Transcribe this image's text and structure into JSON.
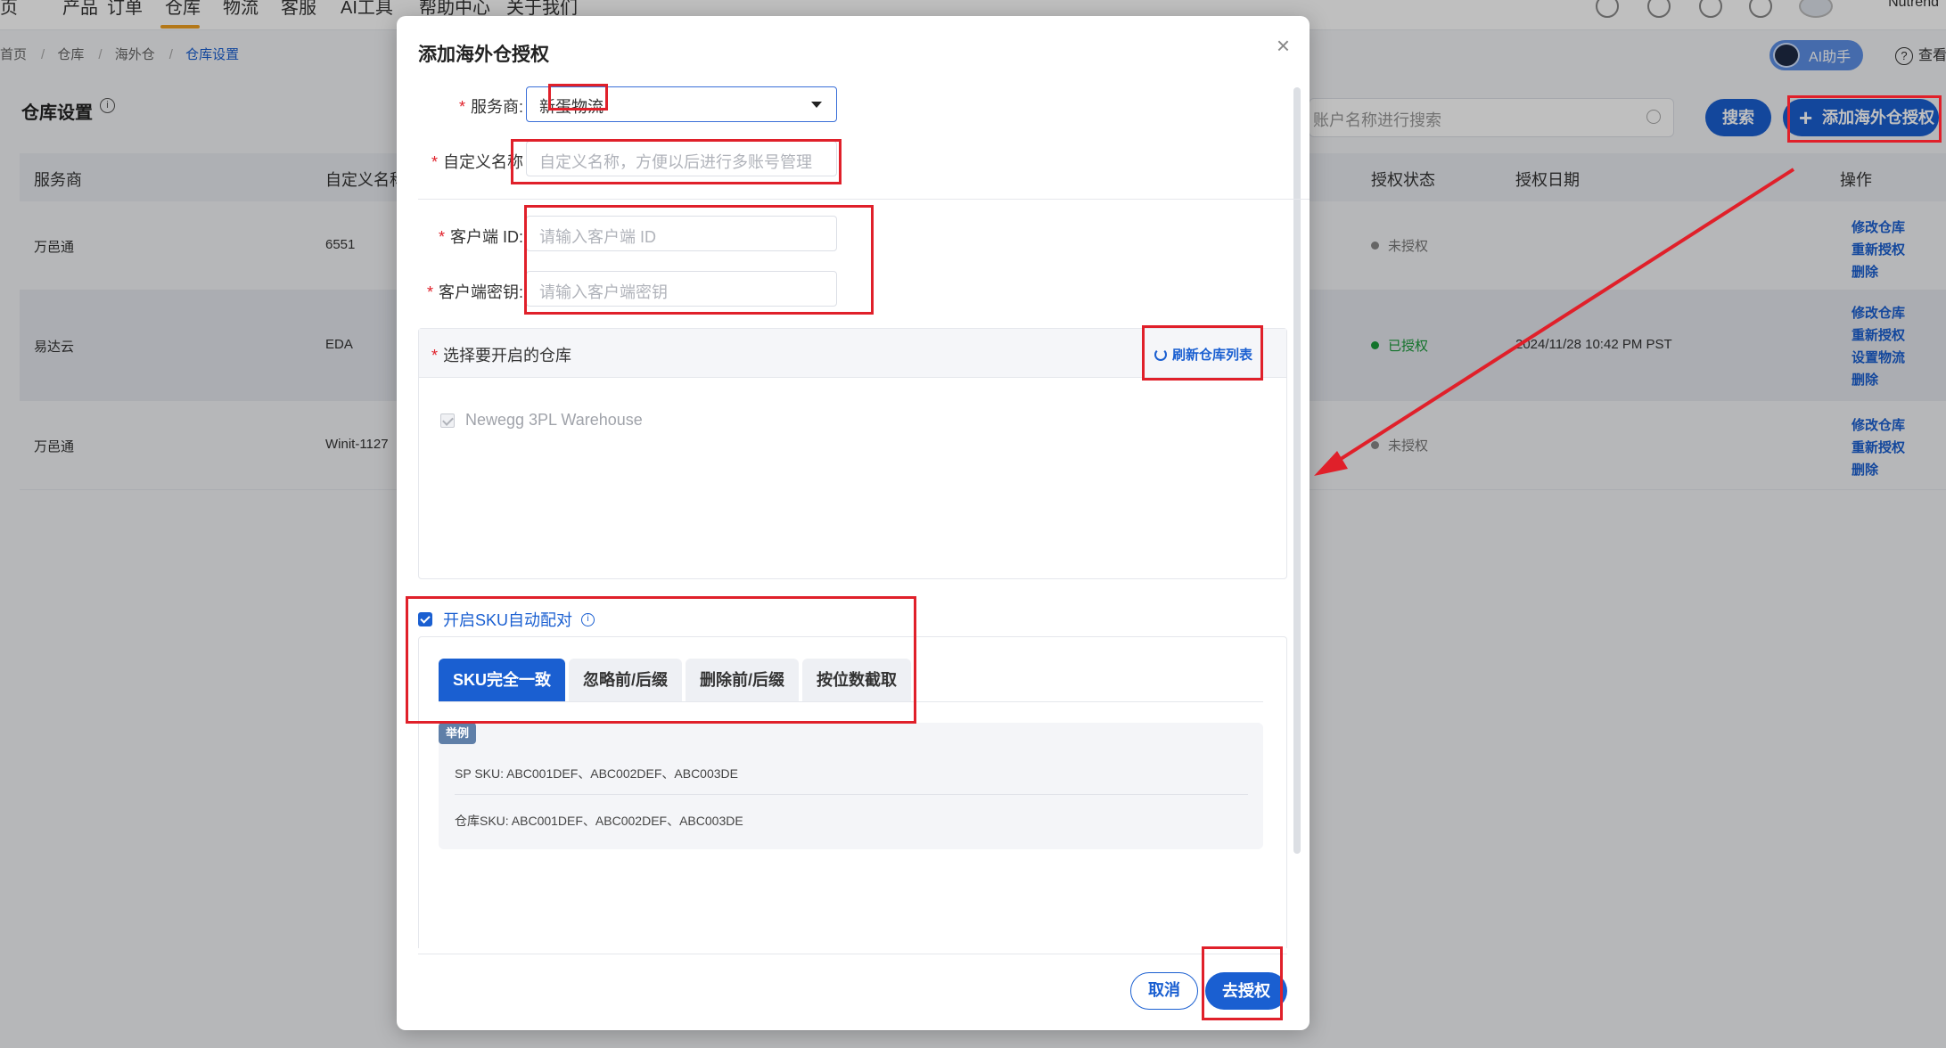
{
  "topnav": {
    "items": [
      "页",
      "产品",
      "订单",
      "仓库",
      "物流",
      "客服",
      "AI工具",
      "帮助中心",
      "关于我们"
    ],
    "active_index": 3,
    "user_name": "Nutrend",
    "icons": [
      "globe-icon",
      "bell-icon",
      "chat-icon",
      "gear-icon",
      "avatar"
    ]
  },
  "breadcrumb": [
    "首页",
    "仓库",
    "海外仓",
    "仓库设置"
  ],
  "ai_assistant_label": "AI助手",
  "help_label": "查看",
  "page_title": "仓库设置",
  "search": {
    "placeholder": "账户名称进行搜索",
    "button": "搜索"
  },
  "add_button": "添加海外仓授权",
  "table": {
    "headers": [
      "服务商",
      "自定义名称",
      "授权状态",
      "授权日期",
      "操作"
    ],
    "rows": [
      {
        "provider": "万邑通",
        "custom_name": "6551",
        "status": "未授权",
        "status_color": "#888888",
        "date": "",
        "ops": [
          "修改仓库",
          "重新授权",
          "删除"
        ]
      },
      {
        "provider": "易达云",
        "custom_name": "EDA",
        "status": "已授权",
        "status_color": "#1a9a3a",
        "date": "2024/11/28 10:42 PM PST",
        "ops": [
          "修改仓库",
          "重新授权",
          "设置物流",
          "删除"
        ]
      },
      {
        "provider": "万邑通",
        "custom_name": "Winit-1127",
        "status": "未授权",
        "status_color": "#888888",
        "date": "",
        "ops": [
          "修改仓库",
          "重新授权",
          "删除"
        ]
      }
    ]
  },
  "modal": {
    "title": "添加海外仓授权",
    "provider_label": "服务商:",
    "provider_value": "新蛋物流",
    "custom_name_label": "自定义名称",
    "custom_name_placeholder": "自定义名称，方便以后进行多账号管理",
    "client_id_label": "客户端 ID:",
    "client_id_placeholder": "请输入客户端 ID",
    "client_secret_label": "客户端密钥:",
    "client_secret_placeholder": "请输入客户端密钥",
    "warehouse_label": "选择要开启的仓库",
    "refresh_label": "刷新仓库列表",
    "warehouse_item": "Newegg 3PL Warehouse",
    "sku_auto_label": "开启SKU自动配对",
    "sku_tabs": [
      "SKU完全一致",
      "忽略前/后缀",
      "删除前/后缀",
      "按位数截取"
    ],
    "active_tab": 0,
    "example_tag": "举例",
    "example_sp": "SP SKU: ABC001DEF、ABC002DEF、ABC003DE",
    "example_wh": "仓库SKU: ABC001DEF、ABC002DEF、ABC003DE",
    "cancel": "取消",
    "confirm": "去授权"
  },
  "colors": {
    "primary": "#1a5fd1",
    "annotation_red": "#e0202a"
  }
}
